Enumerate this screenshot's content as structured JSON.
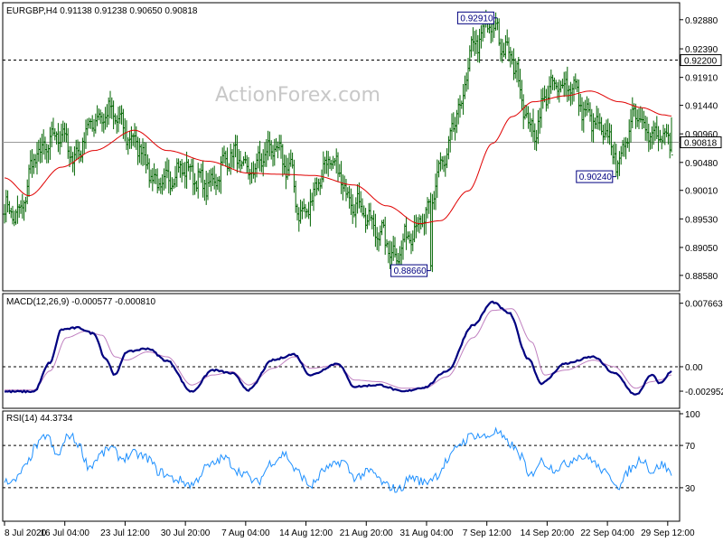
{
  "chart_data": [
    {
      "type": "ohlc",
      "header": "EURGBP,H4  0.91138 0.91238 0.90650 0.90818",
      "symbol": "EURGBP",
      "timeframe": "H4",
      "last_bar": {
        "open": 0.91138,
        "high": 0.91238,
        "low": 0.9065,
        "close": 0.90818
      },
      "watermark": "ActionForex.com",
      "ylim": [
        0.8835,
        0.9312
      ],
      "y_ticks": [
        "0.92880",
        "0.92390",
        "0.91910",
        "0.91440",
        "0.90960",
        "0.90480",
        "0.90010",
        "0.89530",
        "0.89050",
        "0.88580"
      ],
      "x_ticks": [
        "8 Jul 2020",
        "16 Jul 04:00",
        "23 Jul 12:00",
        "30 Jul 20:00",
        "7 Aug 04:00",
        "14 Aug 12:00",
        "21 Aug 20:00",
        "31 Aug 04:00",
        "7 Sep 12:00",
        "14 Sep 20:00",
        "22 Sep 04:00",
        "29 Sep 12:00"
      ],
      "ma_color": "#e00000",
      "bar_color": "#006400",
      "close_anchors": [
        [
          0,
          0.8972
        ],
        [
          8,
          0.8958
        ],
        [
          20,
          0.9062
        ],
        [
          35,
          0.9098
        ],
        [
          42,
          0.9055
        ],
        [
          55,
          0.9118
        ],
        [
          65,
          0.9132
        ],
        [
          80,
          0.9083
        ],
        [
          95,
          0.901
        ],
        [
          110,
          0.9038
        ],
        [
          125,
          0.901
        ],
        [
          140,
          0.9062
        ],
        [
          150,
          0.9032
        ],
        [
          165,
          0.9072
        ],
        [
          175,
          0.904
        ],
        [
          182,
          0.8958
        ],
        [
          200,
          0.9048
        ],
        [
          215,
          0.8982
        ],
        [
          230,
          0.8932
        ],
        [
          240,
          0.8892
        ],
        [
          250,
          0.8932
        ],
        [
          258,
          0.8952
        ],
        [
          270,
          0.905
        ],
        [
          280,
          0.914
        ],
        [
          288,
          0.9245
        ],
        [
          298,
          0.9278
        ],
        [
          310,
          0.923
        ],
        [
          325,
          0.91
        ],
        [
          335,
          0.9172
        ],
        [
          348,
          0.918
        ],
        [
          358,
          0.9128
        ],
        [
          368,
          0.9098
        ],
        [
          378,
          0.9055
        ],
        [
          388,
          0.9135
        ],
        [
          398,
          0.9092
        ],
        [
          410,
          0.9082
        ]
      ],
      "ma_anchors": [
        [
          0,
          0.9022
        ],
        [
          15,
          0.8992
        ],
        [
          35,
          0.904
        ],
        [
          55,
          0.9068
        ],
        [
          80,
          0.9102
        ],
        [
          100,
          0.9068
        ],
        [
          125,
          0.905
        ],
        [
          150,
          0.903
        ],
        [
          170,
          0.9028
        ],
        [
          190,
          0.9026
        ],
        [
          215,
          0.901
        ],
        [
          235,
          0.8975
        ],
        [
          255,
          0.8945
        ],
        [
          268,
          0.895
        ],
        [
          285,
          0.9
        ],
        [
          300,
          0.908
        ],
        [
          312,
          0.9125
        ],
        [
          325,
          0.915
        ],
        [
          345,
          0.916
        ],
        [
          360,
          0.9168
        ],
        [
          378,
          0.915
        ],
        [
          392,
          0.914
        ],
        [
          405,
          0.9128
        ],
        [
          410,
          0.9126
        ]
      ],
      "levels": [
        {
          "label": "0.92200",
          "value": 0.922,
          "style": "dotted"
        },
        {
          "label": "0.90818",
          "value": 0.90818,
          "style": "solid"
        }
      ],
      "annotations": [
        {
          "label": "0.92910",
          "value": 0.9291,
          "bar": 303
        },
        {
          "label": "0.90240",
          "value": 0.9024,
          "bar": 376
        },
        {
          "label": "0.88660",
          "value": 0.8866,
          "bar": 262
        }
      ]
    },
    {
      "type": "line",
      "header": "MACD(12,26,9) -0.000577 -0.000810",
      "indicator": "MACD(12,26,9)",
      "values": {
        "macd": -0.000577,
        "signal": -0.00081
      },
      "ylim": [
        -0.0048,
        0.0085
      ],
      "y_ticks": [
        "0.007663",
        "0.00",
        "-0.002952"
      ],
      "main_color": "#000080",
      "signal_color": "#c080c0",
      "zero_level_dotted": true,
      "main_anchors": [
        [
          0,
          -0.003
        ],
        [
          18,
          -0.003
        ],
        [
          28,
          0.0005
        ],
        [
          35,
          0.0045
        ],
        [
          45,
          0.0047
        ],
        [
          55,
          0.004
        ],
        [
          62,
          0.001
        ],
        [
          68,
          -0.001
        ],
        [
          75,
          0.0018
        ],
        [
          88,
          0.0022
        ],
        [
          100,
          0.0007
        ],
        [
          115,
          -0.003
        ],
        [
          128,
          -0.0004
        ],
        [
          140,
          -0.0008
        ],
        [
          150,
          -0.0028
        ],
        [
          165,
          0.0008
        ],
        [
          178,
          0.0015
        ],
        [
          188,
          -0.001
        ],
        [
          205,
          0.0004
        ],
        [
          215,
          -0.0024
        ],
        [
          230,
          -0.0022
        ],
        [
          245,
          -0.003
        ],
        [
          258,
          -0.0025
        ],
        [
          272,
          -0.0005
        ],
        [
          288,
          0.005
        ],
        [
          300,
          0.0078
        ],
        [
          310,
          0.0065
        ],
        [
          322,
          0.001
        ],
        [
          330,
          -0.002
        ],
        [
          345,
          0.0004
        ],
        [
          362,
          0.0012
        ],
        [
          375,
          -0.0008
        ],
        [
          388,
          -0.0034
        ],
        [
          398,
          -0.001
        ],
        [
          403,
          -0.002
        ],
        [
          410,
          -0.0006
        ]
      ],
      "signal_anchors": [
        [
          0,
          -0.0028
        ],
        [
          18,
          -0.0028
        ],
        [
          28,
          -0.0005
        ],
        [
          38,
          0.0035
        ],
        [
          50,
          0.0043
        ],
        [
          60,
          0.0038
        ],
        [
          68,
          0.0012
        ],
        [
          75,
          0.0008
        ],
        [
          88,
          0.0018
        ],
        [
          100,
          0.0012
        ],
        [
          115,
          -0.0022
        ],
        [
          128,
          -0.001
        ],
        [
          140,
          -0.0006
        ],
        [
          150,
          -0.0022
        ],
        [
          165,
          -0.0002
        ],
        [
          178,
          0.0012
        ],
        [
          188,
          -0.0002
        ],
        [
          205,
          0.0002
        ],
        [
          215,
          -0.0016
        ],
        [
          230,
          -0.0018
        ],
        [
          245,
          -0.0026
        ],
        [
          258,
          -0.0026
        ],
        [
          272,
          -0.0012
        ],
        [
          288,
          0.0035
        ],
        [
          300,
          0.0068
        ],
        [
          312,
          0.007
        ],
        [
          324,
          0.003
        ],
        [
          332,
          -0.001
        ],
        [
          345,
          -0.0004
        ],
        [
          362,
          0.0008
        ],
        [
          375,
          0.0
        ],
        [
          388,
          -0.0026
        ],
        [
          398,
          -0.0018
        ],
        [
          403,
          -0.0016
        ],
        [
          410,
          -0.001
        ]
      ]
    },
    {
      "type": "line",
      "header": "RSI(14) 44.3734",
      "indicator": "RSI(14)",
      "value": 44.3734,
      "ylim": [
        0,
        100
      ],
      "y_ticks": [
        "100",
        "70",
        "30"
      ],
      "line_color": "#1e90ff",
      "levels_dotted": [
        70,
        30
      ],
      "anchors": [
        [
          0,
          38
        ],
        [
          6,
          35
        ],
        [
          12,
          48
        ],
        [
          20,
          70
        ],
        [
          26,
          80
        ],
        [
          32,
          60
        ],
        [
          40,
          80
        ],
        [
          45,
          72
        ],
        [
          52,
          50
        ],
        [
          60,
          62
        ],
        [
          65,
          68
        ],
        [
          72,
          58
        ],
        [
          80,
          62
        ],
        [
          88,
          58
        ],
        [
          95,
          45
        ],
        [
          105,
          38
        ],
        [
          115,
          33
        ],
        [
          125,
          50
        ],
        [
          135,
          58
        ],
        [
          145,
          45
        ],
        [
          155,
          35
        ],
        [
          165,
          55
        ],
        [
          172,
          62
        ],
        [
          180,
          45
        ],
        [
          188,
          32
        ],
        [
          198,
          48
        ],
        [
          208,
          55
        ],
        [
          215,
          40
        ],
        [
          225,
          45
        ],
        [
          235,
          32
        ],
        [
          242,
          28
        ],
        [
          250,
          40
        ],
        [
          258,
          35
        ],
        [
          266,
          42
        ],
        [
          272,
          55
        ],
        [
          280,
          72
        ],
        [
          288,
          80
        ],
        [
          296,
          78
        ],
        [
          302,
          83
        ],
        [
          310,
          72
        ],
        [
          318,
          60
        ],
        [
          322,
          40
        ],
        [
          330,
          55
        ],
        [
          338,
          48
        ],
        [
          345,
          52
        ],
        [
          352,
          60
        ],
        [
          360,
          58
        ],
        [
          366,
          48
        ],
        [
          372,
          40
        ],
        [
          378,
          32
        ],
        [
          385,
          48
        ],
        [
          392,
          58
        ],
        [
          398,
          45
        ],
        [
          404,
          52
        ],
        [
          410,
          44
        ]
      ]
    }
  ]
}
